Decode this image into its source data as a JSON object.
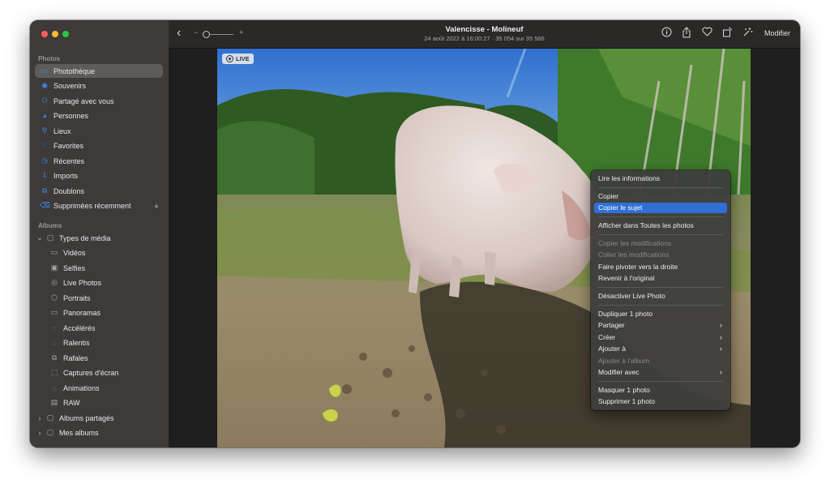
{
  "sidebar": {
    "section_photos": "Photos",
    "items": [
      {
        "label": "Photothèque",
        "icon": "library-icon"
      },
      {
        "label": "Souvenirs",
        "icon": "memories-icon"
      },
      {
        "label": "Partagé avec vous",
        "icon": "shared-with-you-icon"
      },
      {
        "label": "Personnes",
        "icon": "people-icon"
      },
      {
        "label": "Lieux",
        "icon": "places-icon"
      },
      {
        "label": "Favorites",
        "icon": "heart-icon"
      },
      {
        "label": "Récentes",
        "icon": "clock-icon"
      },
      {
        "label": "Imports",
        "icon": "import-icon"
      },
      {
        "label": "Doublons",
        "icon": "duplicates-icon"
      },
      {
        "label": "Supprimées récemment",
        "icon": "trash-icon"
      }
    ],
    "section_albums": "Albums",
    "media_types": {
      "label": "Types de média",
      "items": [
        {
          "label": "Vidéos",
          "icon": "video-icon"
        },
        {
          "label": "Selfies",
          "icon": "selfie-icon"
        },
        {
          "label": "Live Photos",
          "icon": "live-photo-icon"
        },
        {
          "label": "Portraits",
          "icon": "portrait-icon"
        },
        {
          "label": "Panoramas",
          "icon": "panorama-icon"
        },
        {
          "label": "Accélérés",
          "icon": "timelapse-icon"
        },
        {
          "label": "Ralentis",
          "icon": "slomo-icon"
        },
        {
          "label": "Rafales",
          "icon": "burst-icon"
        },
        {
          "label": "Captures d'écran",
          "icon": "screenshot-icon"
        },
        {
          "label": "Animations",
          "icon": "animation-icon"
        },
        {
          "label": "RAW",
          "icon": "raw-icon"
        }
      ]
    },
    "shared_albums": "Albums partagés",
    "my_albums": "Mes albums"
  },
  "toolbar": {
    "title": "Valencisse - Molineuf",
    "subtitle": "24 août 2022 à 16:00:27  ·  35 054 sur 35 566",
    "zoom_minus": "−",
    "zoom_plus": "+",
    "modify_label": "Modifier"
  },
  "photo": {
    "live_label": "LIVE"
  },
  "context_menu": {
    "items": [
      {
        "label": "Lire les informations"
      },
      {
        "label": "Copier"
      },
      {
        "label": "Copier le sujet",
        "highlighted": true
      },
      {
        "label": "Afficher dans Toutes les photos"
      },
      {
        "label": "Copier les modifications",
        "disabled": true
      },
      {
        "label": "Coller les modifications",
        "disabled": true
      },
      {
        "label": "Faire pivoter vers la droite"
      },
      {
        "label": "Revenir à l'original"
      },
      {
        "label": "Désactiver Live Photo"
      },
      {
        "label": "Dupliquer 1 photo"
      },
      {
        "label": "Partager",
        "submenu": true
      },
      {
        "label": "Créer",
        "submenu": true
      },
      {
        "label": "Ajouter à",
        "submenu": true
      },
      {
        "label": "Ajouter à l'album",
        "disabled": true
      },
      {
        "label": "Modifier avec",
        "submenu": true
      },
      {
        "label": "Masquer 1 photo"
      },
      {
        "label": "Supprimer 1 photo"
      }
    ]
  },
  "colors": {
    "accent": "#3b8bf5",
    "menu_highlight": "#2f6fd6",
    "sidebar_bg": "#3d3a39",
    "toolbar_bg": "#2b2827"
  }
}
